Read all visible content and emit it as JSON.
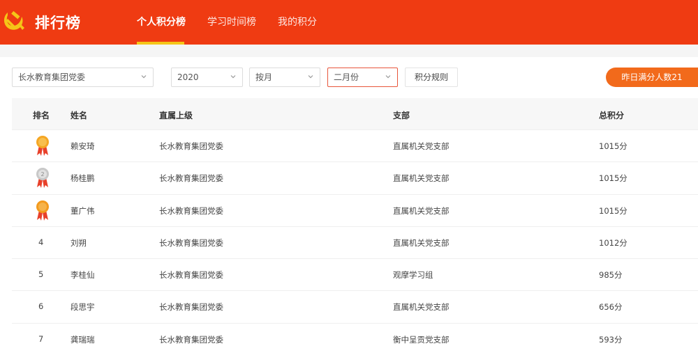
{
  "header": {
    "logo_text": "排行榜",
    "tabs": [
      {
        "label": "个人积分榜",
        "active": true
      },
      {
        "label": "学习时间榜",
        "active": false
      },
      {
        "label": "我的积分",
        "active": false
      }
    ]
  },
  "filters": {
    "organization": "长水教育集团党委",
    "year": "2020",
    "period": "按月",
    "month": "二月份",
    "rules_button": "积分规则",
    "badge": "昨日满分人数21"
  },
  "table": {
    "columns": [
      "排名",
      "姓名",
      "直属上级",
      "支部",
      "总积分"
    ],
    "rows": [
      {
        "rank": "1",
        "medal": "gold-medal-icon",
        "name": "赖安琦",
        "superior": "长水教育集团党委",
        "branch": "直属机关党支部",
        "score": "1015分"
      },
      {
        "rank": "2",
        "medal": "silver-medal-icon",
        "name": "杨桂鹏",
        "superior": "长水教育集团党委",
        "branch": "直属机关党支部",
        "score": "1015分"
      },
      {
        "rank": "3",
        "medal": "bronze-medal-icon",
        "name": "董广伟",
        "superior": "长水教育集团党委",
        "branch": "直属机关党支部",
        "score": "1015分"
      },
      {
        "rank": "4",
        "medal": "",
        "name": "刘朔",
        "superior": "长水教育集团党委",
        "branch": "直属机关党支部",
        "score": "1012分"
      },
      {
        "rank": "5",
        "medal": "",
        "name": "李桂仙",
        "superior": "长水教育集团党委",
        "branch": "观摩学习组",
        "score": "985分"
      },
      {
        "rank": "6",
        "medal": "",
        "name": "段思宇",
        "superior": "长水教育集团党委",
        "branch": "直属机关党支部",
        "score": "656分"
      },
      {
        "rank": "7",
        "medal": "",
        "name": "龚瑞瑞",
        "superior": "长水教育集团党委",
        "branch": "衡中呈贡党支部",
        "score": "593分"
      }
    ]
  },
  "colors": {
    "header_bg": "#ef3b12",
    "tab_underline": "#f5c518",
    "badge_bg": "#f26a1b",
    "gold": "#f5a623",
    "silver": "#c8c8c8",
    "ribbon": "#e8402a"
  }
}
